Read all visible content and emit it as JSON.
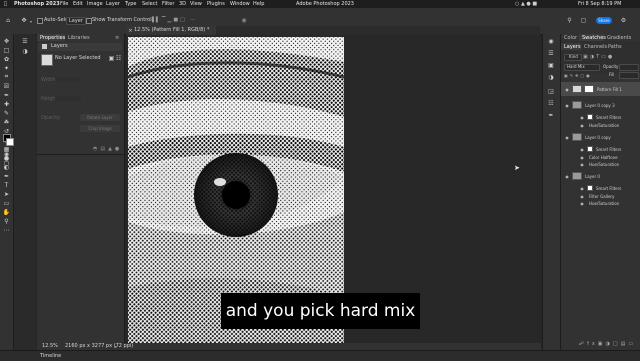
{
  "menubar": {
    "app_name": "Photoshop 2023",
    "items": [
      "File",
      "Edit",
      "Image",
      "Layer",
      "Type",
      "Select",
      "Filter",
      "3D",
      "View",
      "Plugins",
      "Window",
      "Help"
    ],
    "window_title": "Adobe Photoshop 2023",
    "datetime": "Fri 8 Sep  8:19 PM"
  },
  "options": {
    "auto_select_label": "Auto-Select:",
    "auto_select_value": "Layer",
    "transform_label": "Show Transform Controls",
    "share_label": "Share"
  },
  "document": {
    "tab_title": "12.5% (Pattern Fill 1, RGB/8) *",
    "zoom": "12.5%",
    "size": "2160 px x 3277 px (72 ppi)"
  },
  "left_panel": {
    "tabs": [
      "Properties",
      "Libraries"
    ],
    "layers_header": "Layers",
    "no_selection": "No Layer Selected",
    "field_labels": [
      "Width",
      "Height",
      "Opacity"
    ],
    "button_labels": [
      "Rotate Layer",
      "Crop Image"
    ]
  },
  "right_panel": {
    "top_tabs": [
      "Color",
      "Swatches",
      "Gradients"
    ],
    "layer_tabs": [
      "Layers",
      "Channels",
      "Paths"
    ],
    "kind_label": "Kind",
    "blend_mode": "Hard Mix",
    "opacity_label": "Opacity",
    "fill_label": "Fill",
    "layers": [
      {
        "name": "Pattern Fill 1",
        "type": "fill",
        "visible": true
      },
      {
        "name": "Layer 0 copy 3",
        "type": "image",
        "visible": true
      },
      {
        "name": "Smart Filters",
        "type": "filter-header",
        "visible": true
      },
      {
        "name": "Hue/Saturation",
        "type": "filter",
        "visible": true
      },
      {
        "name": "Layer 0 copy",
        "type": "image",
        "visible": true
      },
      {
        "name": "Smart Filters",
        "type": "filter-header",
        "visible": true
      },
      {
        "name": "Color Halftone",
        "type": "filter",
        "visible": true
      },
      {
        "name": "Hue/Saturation",
        "type": "filter",
        "visible": true
      },
      {
        "name": "Layer 0",
        "type": "image",
        "visible": true
      },
      {
        "name": "Smart Filters",
        "type": "filter-header",
        "visible": true
      },
      {
        "name": "Filter Gallery",
        "type": "filter",
        "visible": true
      },
      {
        "name": "Hue/Saturation",
        "type": "filter",
        "visible": true
      }
    ]
  },
  "timeline_label": "Timeline",
  "subtitle": "and you pick hard mix",
  "colors": {
    "accent": "#1473e6",
    "menubar_bg": "#1e1e1e",
    "panel_bg": "#323232",
    "canvas_bg": "#282828"
  }
}
